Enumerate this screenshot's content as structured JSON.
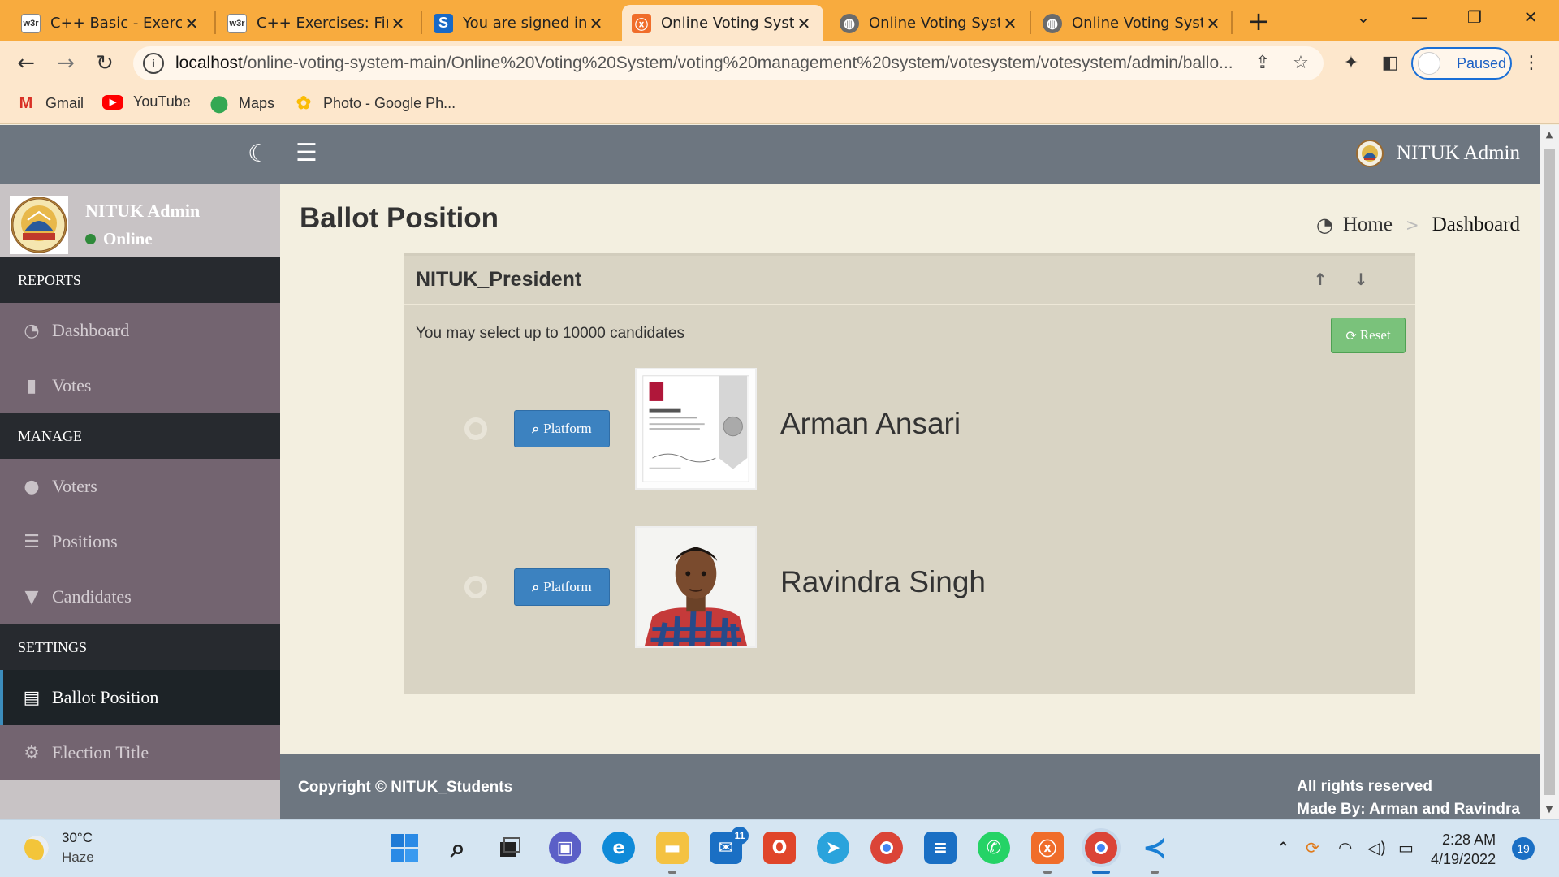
{
  "browser": {
    "tabs": [
      {
        "label": "C++ Basic - Exercis",
        "favicon": "w3r"
      },
      {
        "label": "C++ Exercises: Find",
        "favicon": "w3r"
      },
      {
        "label": "You are signed in a",
        "favicon": "S"
      },
      {
        "label": "Online Voting Syste",
        "favicon": "xampp-icon"
      },
      {
        "label": "Online Voting Syste",
        "favicon": "globe-icon"
      },
      {
        "label": "Online Voting Syste",
        "favicon": "globe-icon"
      }
    ],
    "active_tab_index": 3,
    "url_host": "localhost",
    "url_path": "/online-voting-system-main/Online%20Voting%20System/voting%20management%20system/votesystem/votesystem/admin/ballo...",
    "profile_status": "Paused",
    "bookmarks": [
      {
        "label": "Gmail",
        "icon": "gmail-icon"
      },
      {
        "label": "YouTube",
        "icon": "youtube-icon"
      },
      {
        "label": "Maps",
        "icon": "maps-icon"
      },
      {
        "label": "Photo - Google Ph...",
        "icon": "google-photos-icon"
      }
    ]
  },
  "app": {
    "header_user": "NITUK Admin",
    "sidebar": {
      "user_name": "NITUK Admin",
      "user_status": "Online",
      "sections": [
        {
          "header": "REPORTS",
          "items": [
            {
              "label": "Dashboard",
              "icon": "dashboard-icon"
            },
            {
              "label": "Votes",
              "icon": "lock-icon"
            }
          ]
        },
        {
          "header": "MANAGE",
          "items": [
            {
              "label": "Voters",
              "icon": "users-icon"
            },
            {
              "label": "Positions",
              "icon": "list-icon"
            },
            {
              "label": "Candidates",
              "icon": "tie-icon"
            }
          ]
        },
        {
          "header": "SETTINGS",
          "items": [
            {
              "label": "Ballot Position",
              "icon": "file-icon",
              "active": true
            },
            {
              "label": "Election Title",
              "icon": "cogs-icon"
            }
          ]
        }
      ]
    },
    "page_title": "Ballot Position",
    "breadcrumb": {
      "home": "Home",
      "current": "Dashboard"
    },
    "ballot": {
      "position": "NITUK_President",
      "instruction": "You may select up to 10000 candidates",
      "reset_label": "Reset",
      "candidates": [
        {
          "name": "Arman Ansari",
          "platform_label": "Platform"
        },
        {
          "name": "Ravindra Singh",
          "platform_label": "Platform"
        }
      ]
    },
    "footer": {
      "copyright": "Copyright © NITUK_Students",
      "rights": "All rights reserved",
      "made_by": "Made By: Arman and Ravindra"
    }
  },
  "taskbar": {
    "weather_temp": "30°C",
    "weather_cond": "Haze",
    "mail_badge": "11",
    "time": "2:28 AM",
    "date": "4/19/2022",
    "notification_count": "19"
  },
  "colors": {
    "tabbar": "#f8ab3e",
    "topnav": "#6d7680",
    "sidebar": "#736470",
    "content_bg": "#f3efe0",
    "reset_button": "#7ac27b",
    "platform_button": "#3c82c0"
  }
}
